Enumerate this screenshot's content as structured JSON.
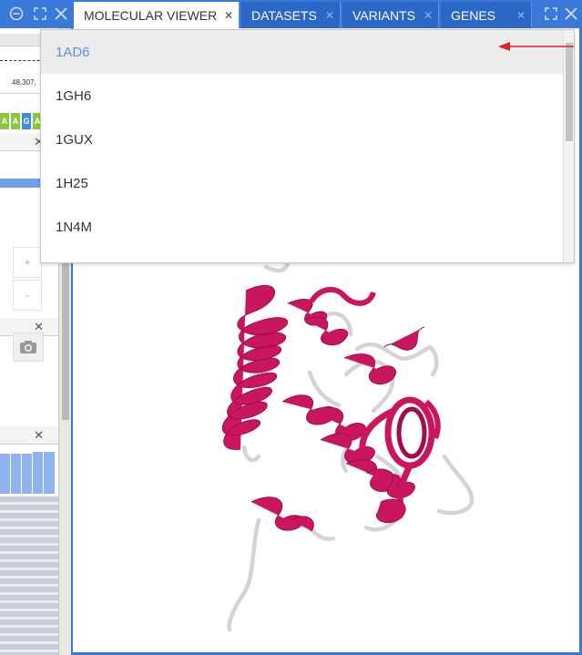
{
  "tabs": [
    {
      "label": "MOLECULAR VIEWER",
      "active": true
    },
    {
      "label": "DATASETS",
      "active": false
    },
    {
      "label": "VARIANTS",
      "active": false
    },
    {
      "label": "GENES",
      "active": false
    }
  ],
  "window_controls": {
    "minimize_icon": "minus-circle-icon",
    "expand_icon": "expand-icon",
    "close_icon": "close-icon",
    "right_expand_icon": "expand-icon",
    "right_close_icon": "close-icon"
  },
  "left_panel": {
    "coordinate_top": "114",
    "coordinate_label": "48,307,",
    "bases": [
      "A",
      "A",
      "G",
      "A"
    ],
    "zoom_in": "+",
    "zoom_out": "-"
  },
  "structure_dropdown": {
    "items": [
      "1AD6",
      "1GH6",
      "1GUX",
      "1H25",
      "1N4M"
    ],
    "selected": "1AD6"
  },
  "colors": {
    "accent_blue": "#3b79d9",
    "selected_text": "#5b8ee6",
    "helix": "#c9165e",
    "coil": "#d4d4d4",
    "pointer_arrow": "#e02020",
    "base_A": "#8bc63f",
    "base_G": "#3b8fd4"
  }
}
